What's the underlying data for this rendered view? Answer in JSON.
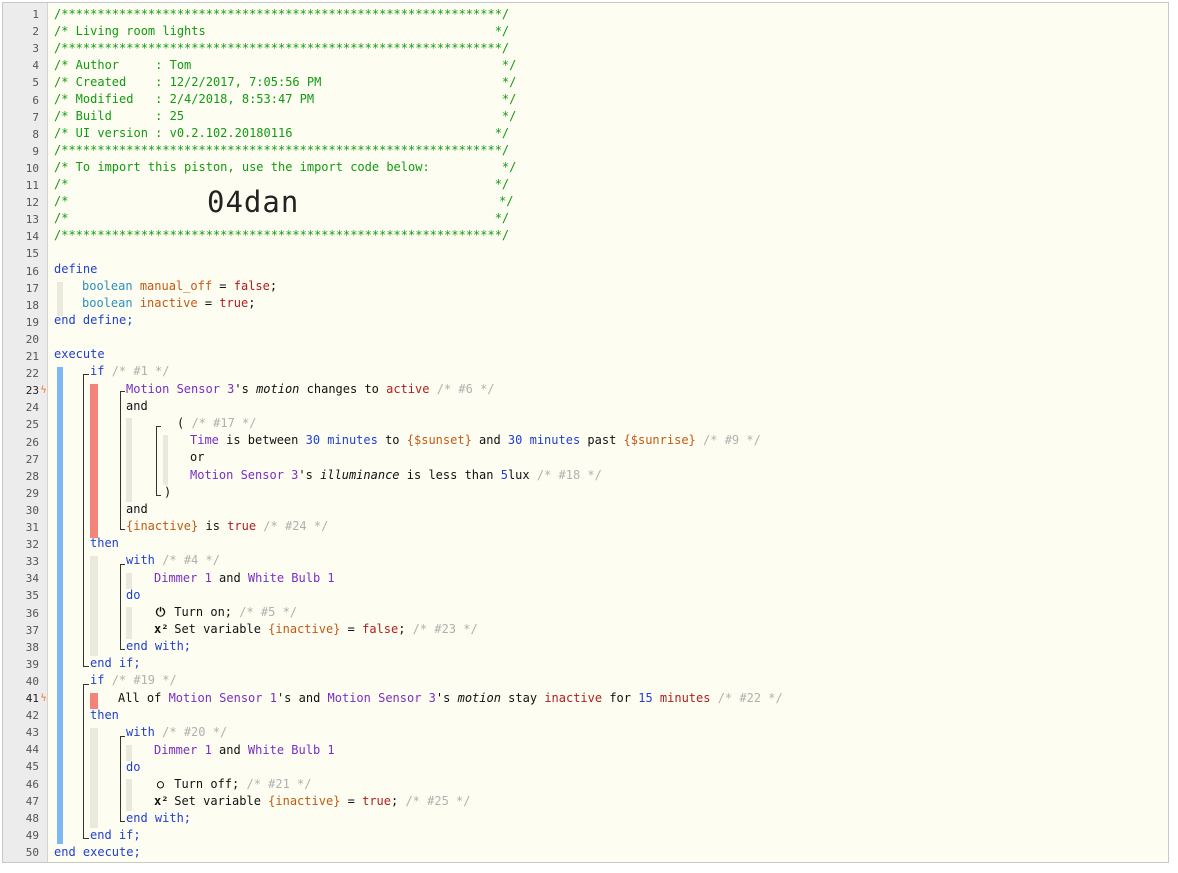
{
  "editor": {
    "line_count": 50,
    "bolt_lines": [
      23,
      41
    ],
    "bolt_glyph": "ϟ"
  },
  "header": {
    "rule": "/*************************************************************/",
    "title_line": "/* Living room lights                                        */",
    "author_line": "/* Author     : Tom                                           */",
    "created_line": "/* Created    : 12/2/2017, 7:05:56 PM                         */",
    "modified_line": "/* Modified   : 2/4/2018, 8:53:47 PM                          */",
    "build_line": "/* Build      : 25                                            */",
    "ui_line": "/* UI version : v0.2.102.20180116                            */",
    "import_line": "/* To import this piston, use the import code below:          */",
    "blank_line": "/*                                                           */",
    "code_prefix": "/*",
    "code_suffix": "*/",
    "import_code": "04dan"
  },
  "define": {
    "open": "define",
    "close": "end define;",
    "vars": [
      {
        "type": "boolean",
        "name": "manual_off",
        "eq": " = ",
        "value": "false",
        "semi": ";"
      },
      {
        "type": "boolean",
        "name": "inactive",
        "eq": " = ",
        "value": "true",
        "semi": ";"
      }
    ]
  },
  "execute": {
    "open": "execute",
    "close": "end execute;",
    "if1": {
      "kw": "if",
      "cmt": "/* #1 */",
      "c1_dev": "Motion Sensor 3",
      "c1_poss": "'s ",
      "c1_attr": "motion",
      "c1_op": " changes to ",
      "c1_val": "active",
      "c1_cmt": "/* #6 */",
      "and1": "and",
      "group_open": "( ",
      "group_cmt": "/* #17 */",
      "g1_dev": "Time",
      "g1_op1": " is between ",
      "g1_n1": "30",
      "g1_u1": " minutes",
      "g1_to": " to ",
      "g1_v1": "{$sunset}",
      "g1_and": " and ",
      "g1_n2": "30",
      "g1_u2": " minutes",
      "g1_past": " past ",
      "g1_v2": "{$sunrise}",
      "g1_cmt": "/* #9 */",
      "or": "or",
      "g2_dev": "Motion Sensor 3",
      "g2_poss": "'s ",
      "g2_attr": "illuminance",
      "g2_op": " is less than ",
      "g2_n": "5",
      "g2_u": "lux",
      "g2_cmt": "/* #18 */",
      "group_close": ")",
      "and2": "and",
      "c3_var": "{inactive}",
      "c3_op": " is ",
      "c3_val": "true",
      "c3_cmt": "/* #24 */",
      "then": "then",
      "with": "with",
      "with_cmt": "/* #4 */",
      "dev1": "Dimmer 1",
      "dev_and": " and ",
      "dev2": "White Bulb 1",
      "do": "do",
      "a1_icon": "⏻",
      "a1_text": " Turn on; ",
      "a1_cmt": "/* #5 */",
      "a2_icon": "x²",
      "a2_text": " Set variable ",
      "a2_var": "{inactive}",
      "a2_eq": " = ",
      "a2_val": "false",
      "a2_semi": "; ",
      "a2_cmt": "/* #23 */",
      "end_with": "end with;",
      "end_if": "end if;"
    },
    "if2": {
      "kw": "if",
      "cmt": "/* #19 */",
      "c_all": "All of ",
      "c_dev1": "Motion Sensor 1",
      "c_poss1": "'s and ",
      "c_dev2": "Motion Sensor 3",
      "c_poss2": "'s ",
      "c_attr": "motion",
      "c_op": " stay ",
      "c_val": "inactive",
      "c_for": " for ",
      "c_n": "15",
      "c_u": " minutes",
      "c_cmt": "/* #22 */",
      "then": "then",
      "with": "with",
      "with_cmt": "/* #20 */",
      "dev1": "Dimmer 1",
      "dev_and": " and ",
      "dev2": "White Bulb 1",
      "do": "do",
      "a1_icon": "○",
      "a1_text": " Turn off; ",
      "a1_cmt": "/* #21 */",
      "a2_icon": "x²",
      "a2_text": " Set variable ",
      "a2_var": "{inactive}",
      "a2_eq": " = ",
      "a2_val": "true",
      "a2_semi": "; ",
      "a2_cmt": "/* #25 */",
      "end_with": "end with;",
      "end_if": "end if;"
    }
  },
  "colors": {
    "comment": "#119b11",
    "keyword": "#1f3fd1",
    "type": "#2a8fbd",
    "variable": "#c25a14",
    "device": "#7a2fc4",
    "value": "#b21d1d",
    "faded_comment": "#b0b0b0",
    "gutter_bolt": "#f07b2b",
    "block_bar_blue": "#7fb7f2",
    "block_bar_red": "#f2847a",
    "block_bar_beige": "#eae9dc"
  }
}
